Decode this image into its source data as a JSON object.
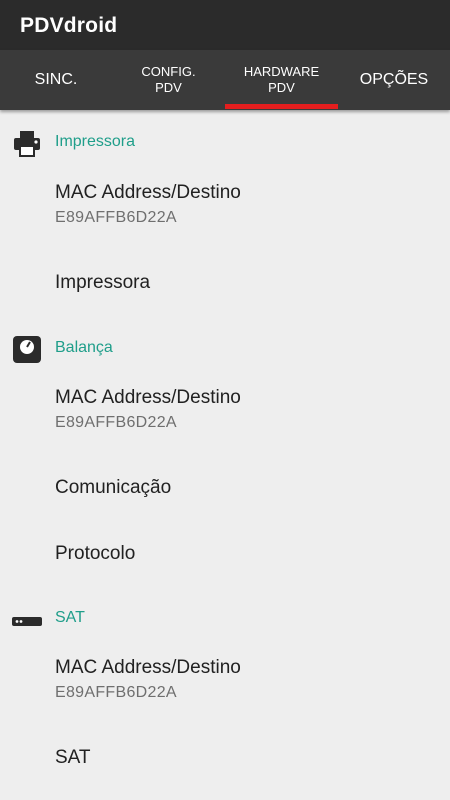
{
  "app": {
    "title": "PDVdroid"
  },
  "tabs": [
    {
      "label": "SINC."
    },
    {
      "label": "CONFIG.\nPDV"
    },
    {
      "label": "HARDWARE\nPDV"
    },
    {
      "label": "OPÇÕES"
    }
  ],
  "active_tab": "HARDWARE PDV",
  "colors": {
    "accent": "#1f9e8a",
    "indicator": "#e41e1e",
    "appbar": "#2b2b2b",
    "tabbar": "#3a3a3a"
  },
  "sections": {
    "impressora": {
      "header": "Impressora",
      "icon": "printer-icon",
      "mac": {
        "title": "MAC Address/Destino",
        "summary": "E89AFFB6D22A"
      },
      "device": {
        "title": "Impressora"
      }
    },
    "balanca": {
      "header": "Balança",
      "icon": "scale-icon",
      "mac": {
        "title": "MAC Address/Destino",
        "summary": "E89AFFB6D22A"
      },
      "comunicacao": {
        "title": "Comunicação"
      },
      "protocolo": {
        "title": "Protocolo"
      }
    },
    "sat": {
      "header": "SAT",
      "icon": "sat-device-icon",
      "mac": {
        "title": "MAC Address/Destino",
        "summary": "E89AFFB6D22A"
      },
      "device": {
        "title": "SAT"
      }
    }
  }
}
